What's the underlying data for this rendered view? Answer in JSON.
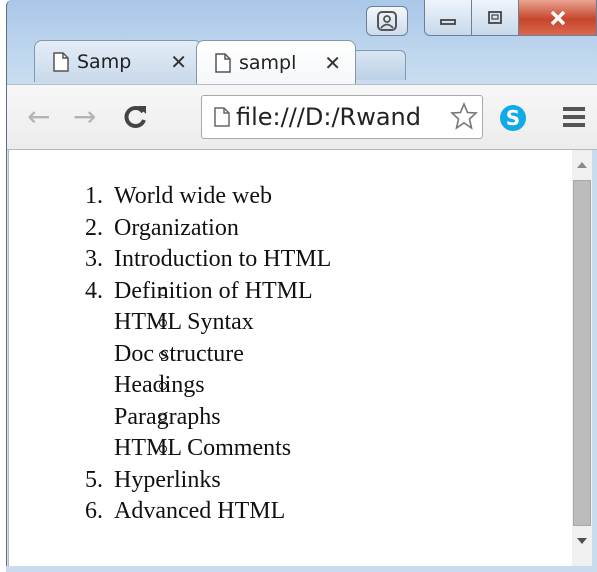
{
  "browser": {
    "tabs": [
      {
        "label": "Samp",
        "active": false
      },
      {
        "label": "sampl",
        "active": true
      }
    ],
    "address": "file:///D:/Rwand",
    "icons": {
      "back": "back-arrow-icon",
      "forward": "forward-arrow-icon",
      "reload": "reload-icon",
      "star": "star-icon",
      "skype": "skype-icon",
      "menu": "hamburger-menu-icon"
    },
    "skype_glyph": "S",
    "colors": {
      "close": "#c7452b",
      "skype": "#12a9e8"
    }
  },
  "page": {
    "list": [
      {
        "num": "1.",
        "text": "World wide web"
      },
      {
        "num": "2.",
        "text": "Organization"
      },
      {
        "num": "3.",
        "text": "Introduction to HTML"
      },
      {
        "num": "4.",
        "text": "",
        "sub": [
          "Definition of HTML",
          "HTML Syntax",
          "Doc structure",
          "Headings",
          "Paragraphs",
          "HTML Comments"
        ]
      },
      {
        "num": "5.",
        "text": "Hyperlinks"
      },
      {
        "num": "6.",
        "text": "Advanced HTML"
      }
    ]
  }
}
